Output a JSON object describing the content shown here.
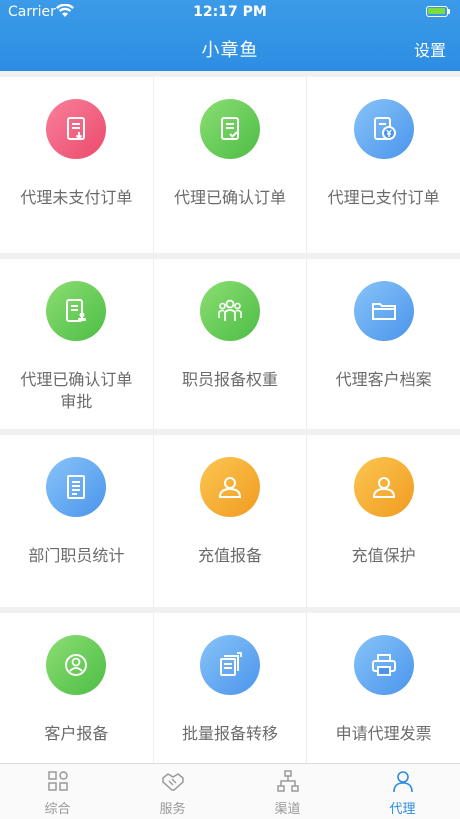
{
  "status_bar": {
    "carrier": "Carrier",
    "time": "12:17 PM"
  },
  "nav": {
    "title": "小章鱼",
    "settings_label": "设置"
  },
  "grid": {
    "rows": [
      [
        {
          "label": "代理未支付订单",
          "icon": "document-download-icon",
          "color": "#ec4a6c"
        },
        {
          "label": "代理已确认订单",
          "icon": "document-check-icon",
          "color": "#4cbd45"
        },
        {
          "label": "代理已支付订单",
          "icon": "document-yen-icon",
          "color": "#4a94ec"
        }
      ],
      [
        {
          "label": "代理已确认订单审批",
          "icon": "document-stamp-icon",
          "color": "#4cbd45"
        },
        {
          "label": "职员报备权重",
          "icon": "team-icon",
          "color": "#4cbd45"
        },
        {
          "label": "代理客户档案",
          "icon": "folder-icon",
          "color": "#4a94ec"
        }
      ],
      [
        {
          "label": "部门职员统计",
          "icon": "document-lines-icon",
          "color": "#4a94ec"
        },
        {
          "label": "充值报备",
          "icon": "user-icon",
          "color": "#f19b1f"
        },
        {
          "label": "充值保护",
          "icon": "user-icon",
          "color": "#f19b1f"
        }
      ],
      [
        {
          "label": "客户报备",
          "icon": "person-icon",
          "color": "#4cbd45"
        },
        {
          "label": "批量报备转移",
          "icon": "batch-transfer-icon",
          "color": "#4a94ec"
        },
        {
          "label": "申请代理发票",
          "icon": "printer-icon",
          "color": "#4a94ec"
        }
      ]
    ]
  },
  "tabbar": {
    "tabs": [
      {
        "label": "综合",
        "icon": "grid-shapes-icon",
        "active": false
      },
      {
        "label": "服务",
        "icon": "handshake-icon",
        "active": false
      },
      {
        "label": "渠道",
        "icon": "network-icon",
        "active": false
      },
      {
        "label": "代理",
        "icon": "agent-user-icon",
        "active": true
      }
    ],
    "active_color": "#2c8de3"
  }
}
